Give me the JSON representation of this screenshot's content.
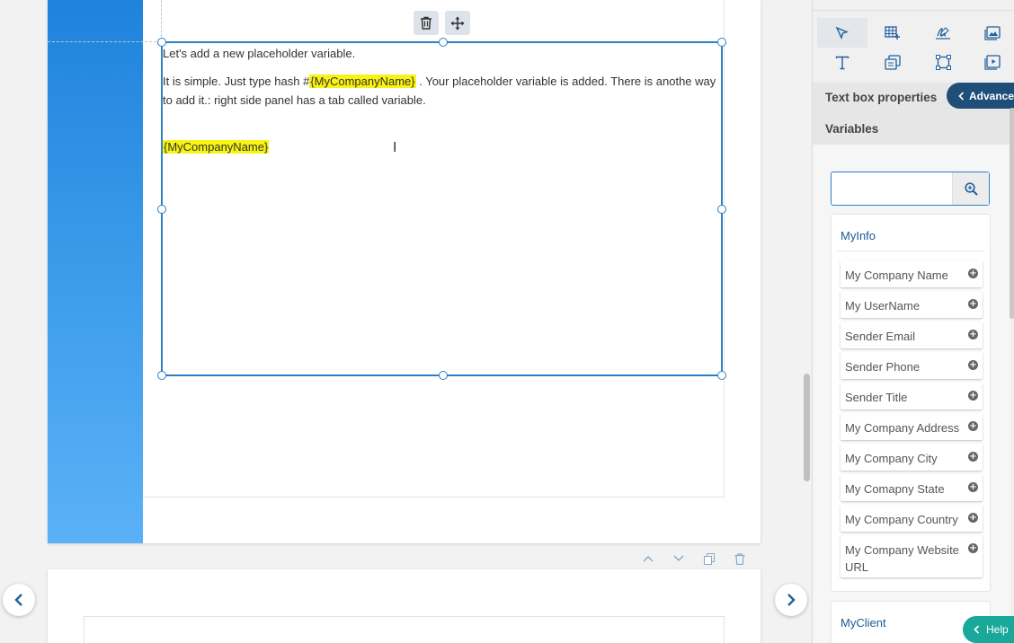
{
  "editor": {
    "toolbar": {
      "delete_icon": "trash-icon",
      "move_icon": "move-icon"
    },
    "textbox": {
      "line1": "Let's add a new placeholder variable.",
      "line2_before": "It is simple. Just type hash #",
      "line2_var": "{MyCompanyName}",
      "line2_after": " . Your placeholder variable is added. There is anothe way to add it.: right side panel has a tab called variable.",
      "line3_var": "{MyCompanyName}"
    },
    "page_actions": [
      "chevron-up-icon",
      "chevron-down-icon",
      "copy-icon",
      "trash-icon"
    ],
    "nav": {
      "prev_icon": "chevron-left-icon",
      "next_icon": "chevron-right-icon"
    }
  },
  "panel": {
    "tools": [
      "pointer-icon",
      "table-add-icon",
      "signature-icon",
      "image-icon",
      "text-icon",
      "copy-field-icon",
      "shape-icon",
      "video-icon"
    ],
    "properties_title": "Text box properties",
    "advance_label": "Advance",
    "variables_title": "Variables",
    "search": {
      "placeholder": "",
      "icon": "search-icon"
    },
    "groups": [
      {
        "title": "MyInfo",
        "items": [
          "My Company Name",
          "My UserName",
          "Sender Email",
          "Sender Phone",
          "Sender Title",
          "My Company Address",
          "My Company City",
          "My Comapny State",
          "My Company Country",
          "My Company Website URL"
        ]
      },
      {
        "title": "MyClient",
        "items": []
      }
    ],
    "help_label": "Help"
  },
  "colors": {
    "accent": "#2e80c6",
    "highlight": "#f7f312",
    "advance_bg": "#1f4e79",
    "help_bg": "#1aa89a"
  }
}
